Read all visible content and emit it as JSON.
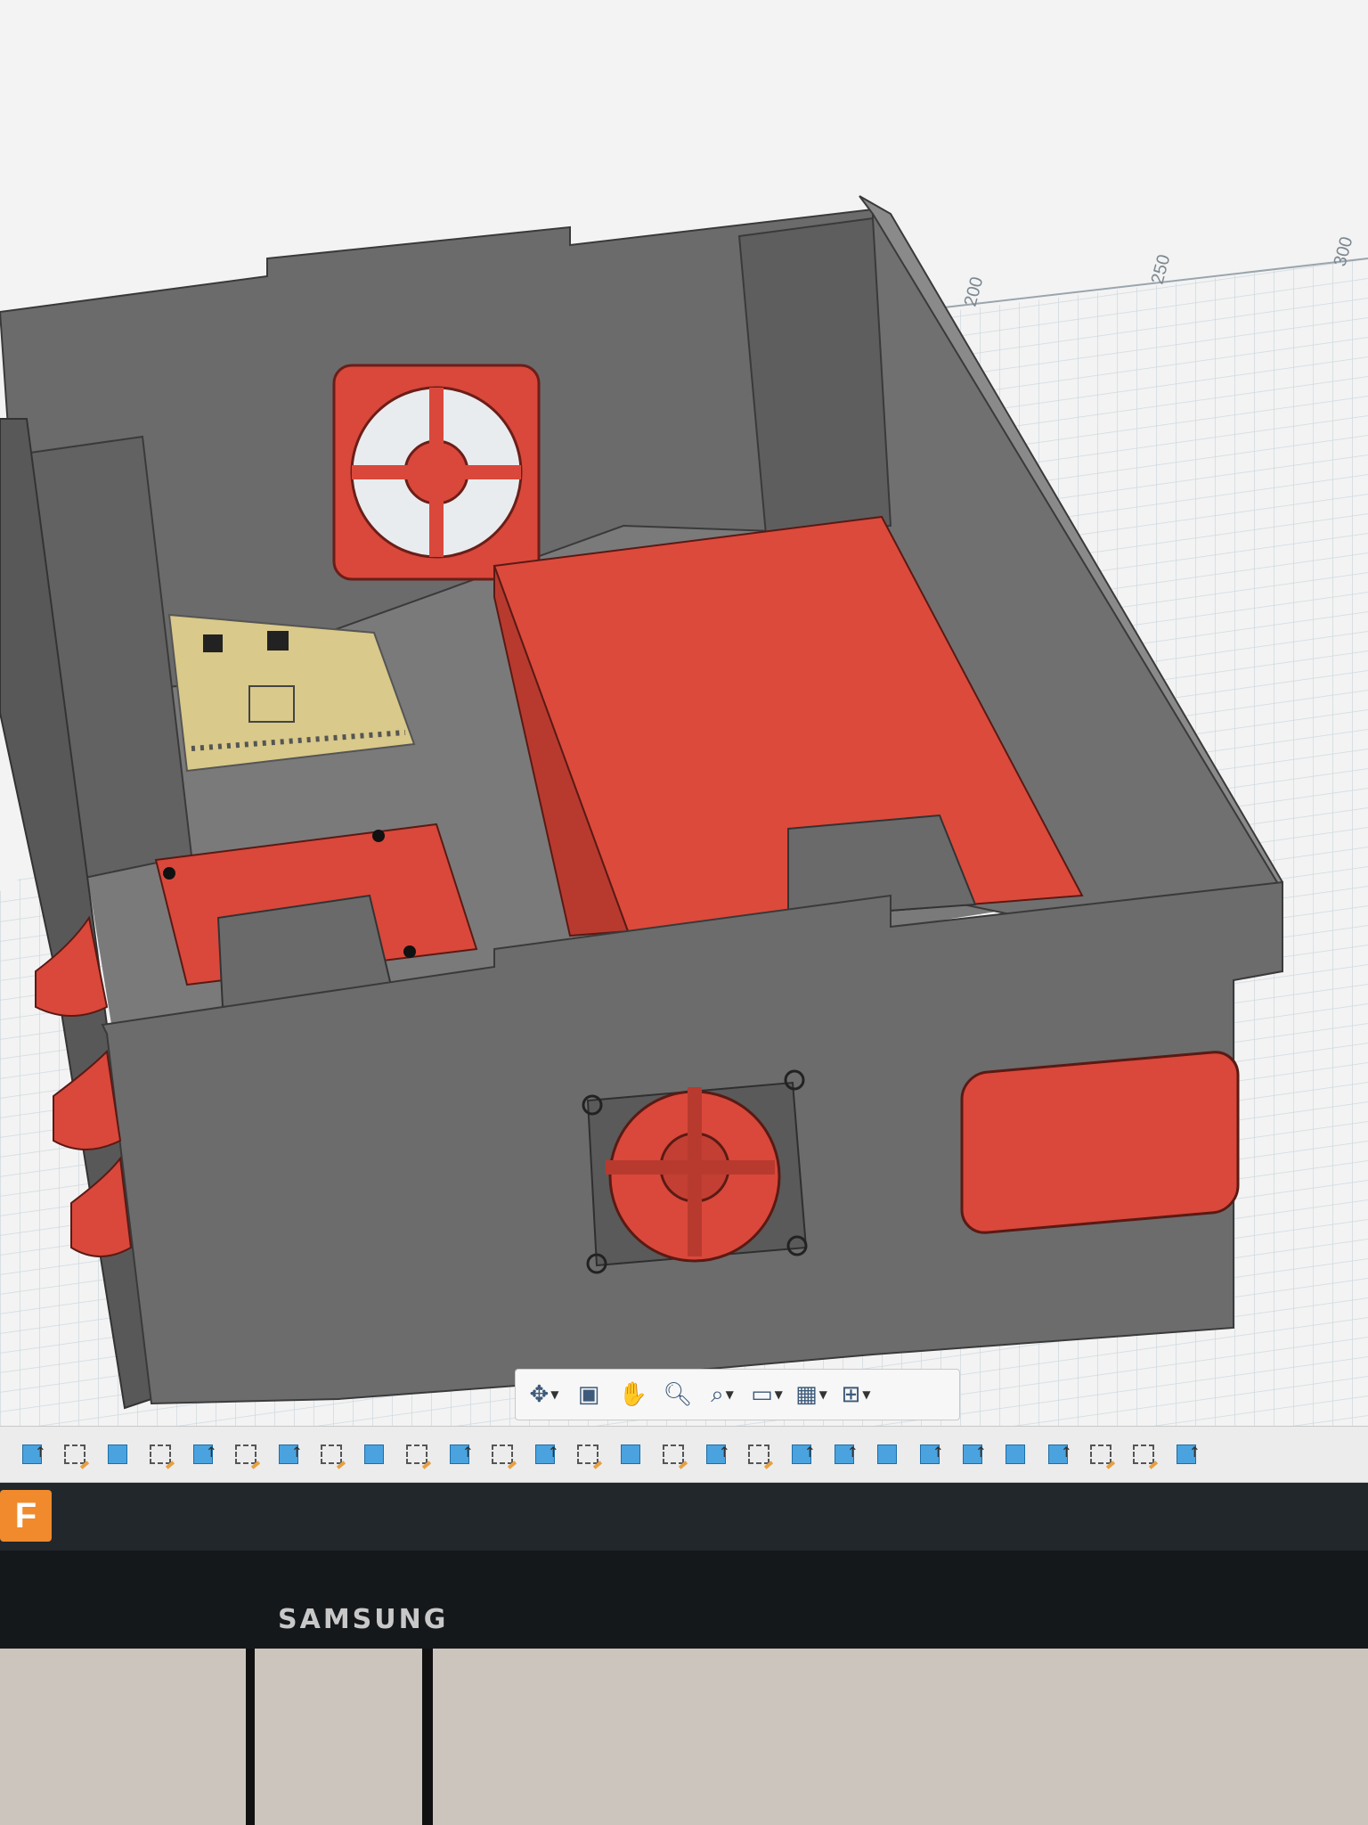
{
  "viewport": {
    "grid_labels": [
      "200",
      "250",
      "300"
    ]
  },
  "navigation_bar": {
    "tools": [
      {
        "name": "orbit",
        "icon": "orbit-icon",
        "has_dropdown": true
      },
      {
        "name": "look-at",
        "icon": "look-at-icon",
        "has_dropdown": false
      },
      {
        "name": "pan",
        "icon": "hand-pan-icon",
        "has_dropdown": false
      },
      {
        "name": "zoom",
        "icon": "zoom-icon",
        "has_dropdown": false
      },
      {
        "name": "fit",
        "icon": "zoom-window-icon",
        "has_dropdown": true
      },
      {
        "name": "display-settings",
        "icon": "monitor-icon",
        "has_dropdown": true
      },
      {
        "name": "grid-and-snaps",
        "icon": "grid-icon",
        "has_dropdown": true
      },
      {
        "name": "viewports",
        "icon": "viewports-icon",
        "has_dropdown": true
      }
    ]
  },
  "timeline": {
    "items": [
      "body",
      "sketch",
      "body",
      "sketch",
      "body",
      "sketch",
      "body",
      "sketch",
      "body",
      "sketch",
      "body",
      "sketch",
      "body",
      "sketch",
      "body",
      "sketch",
      "body",
      "sketch",
      "body",
      "body",
      "body",
      "body",
      "body",
      "body",
      "body",
      "sketch",
      "sketch",
      "body"
    ]
  },
  "taskbar": {
    "app_badge": "F"
  },
  "monitor": {
    "brand": "SAMSUNG"
  },
  "colors": {
    "enclosure": "#6e6e6e",
    "enclosure_dark": "#4e4e4e",
    "red_parts": "#d9483b",
    "board": "#d9c98a"
  }
}
